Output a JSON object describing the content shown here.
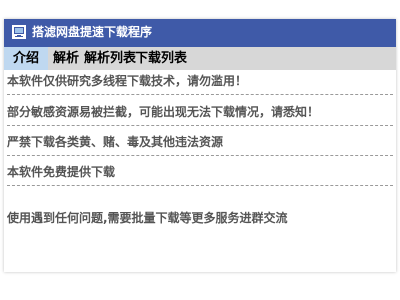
{
  "window": {
    "title": "搭滤网盘提速下载程序",
    "icon": "app-icon"
  },
  "tabs": [
    {
      "label": "介绍",
      "active": true
    },
    {
      "label": "解析",
      "active": false
    },
    {
      "label": "解析列表",
      "active": false
    },
    {
      "label": "下载列表",
      "active": false
    }
  ],
  "content": {
    "lines": [
      "本软件仅供研究多线程下载技术，请勿滥用！",
      "部分敏感资源易被拦截，可能出现无法下载情况，请悉知！",
      "严禁下载各类黄、赌、毒及其他违法资源",
      "本软件免费提供下载",
      "使用遇到任何问题,需要批量下载等更多服务进群交流"
    ]
  },
  "colors": {
    "titlebar": "#3f5aa8",
    "tab_active": "#bfd8f0",
    "tabbar": "#d7d7d7",
    "text": "#555555"
  }
}
